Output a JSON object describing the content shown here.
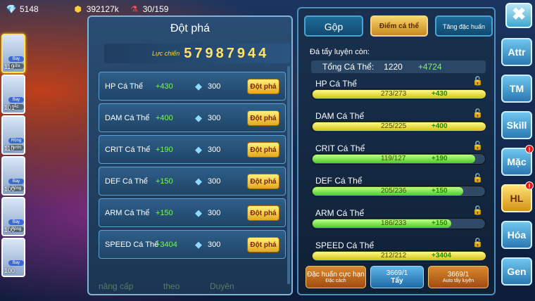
{
  "topbar": {
    "gems": "5148",
    "coins": "392127k",
    "energy": "30/159"
  },
  "creatures": [
    {
      "level": "119",
      "tag1": "Bay",
      "tag2": "Lửa",
      "selected": true
    },
    {
      "level": "101",
      "tag1": "Bay",
      "tag2": "Ác",
      "selected": false
    },
    {
      "level": "110",
      "tag1": "Rồng",
      "tag2": "Nước",
      "selected": false
    },
    {
      "level": "100",
      "tag1": "Bay",
      "tag2": "Rồng",
      "selected": false
    },
    {
      "level": "100",
      "tag1": "Bay",
      "tag2": "Rồng",
      "selected": false
    },
    {
      "level": "100",
      "tag1": "Bay",
      "tag2": "",
      "selected": false
    }
  ],
  "left_panel": {
    "title": "Đột phá",
    "power_label": "Lực chiến",
    "power_value": "57987944",
    "rows": [
      {
        "name": "HP Cá Thể",
        "plus": "+430",
        "cost": "300",
        "button": "Đột phá"
      },
      {
        "name": "DAM Cá Thể",
        "plus": "+400",
        "cost": "300",
        "button": "Đột phá"
      },
      {
        "name": "CRIT Cá Thể",
        "plus": "+190",
        "cost": "300",
        "button": "Đột phá"
      },
      {
        "name": "DEF Cá Thể",
        "plus": "+150",
        "cost": "300",
        "button": "Đột phá"
      },
      {
        "name": "ARM Cá Thể",
        "plus": "+150",
        "cost": "300",
        "button": "Đột phá"
      },
      {
        "name": "SPEED Cá Thể",
        "plus": "+3404",
        "cost": "300",
        "button": "Đột phá"
      }
    ]
  },
  "right_panel": {
    "tabs": [
      "Gộp",
      "Điểm cá thể",
      "Tăng đặc huấn"
    ],
    "remain_label": "Đá tẩy luyện còn:",
    "total_label": "Tổng Cá Thể:",
    "total_value": "1220",
    "total_plus": "+4724",
    "stats": [
      {
        "name": "HP Cá Thể",
        "value": "273/273",
        "plus": "+430",
        "fill": 1.0,
        "green": false
      },
      {
        "name": "DAM Cá Thể",
        "value": "225/225",
        "plus": "+400",
        "fill": 1.0,
        "green": false
      },
      {
        "name": "CRIT Cá Thể",
        "value": "119/127",
        "plus": "+190",
        "fill": 0.94,
        "green": true
      },
      {
        "name": "DEF Cá Thể",
        "value": "205/236",
        "plus": "+150",
        "fill": 0.87,
        "green": true
      },
      {
        "name": "ARM Cá Thể",
        "value": "186/233",
        "plus": "+150",
        "fill": 0.8,
        "green": true
      },
      {
        "name": "SPEED Cá Thể",
        "value": "212/212",
        "plus": "+3404",
        "fill": 1.0,
        "green": false
      }
    ],
    "buttons": {
      "special_top": "Đặc huấn cực hạn",
      "special_sub": "Đặc cách",
      "tay_count": "3669/1",
      "tay_label": "Tẩy",
      "auto_count": "3669/1",
      "auto_label": "Auto tẩy luyện"
    }
  },
  "side_nav": [
    {
      "label": "Attr",
      "badge": "",
      "active": false
    },
    {
      "label": "TM",
      "badge": "",
      "active": false
    },
    {
      "label": "Skill",
      "badge": "",
      "active": false
    },
    {
      "label": "Mặc",
      "badge": "!",
      "active": false
    },
    {
      "label": "HL",
      "badge": "!",
      "active": true
    },
    {
      "label": "Hóa",
      "badge": "",
      "active": false
    },
    {
      "label": "Gen",
      "badge": "",
      "active": false
    }
  ],
  "close_icon": "✖",
  "bg_texts": [
    "nâng cấp",
    "theo",
    "Duyên"
  ]
}
